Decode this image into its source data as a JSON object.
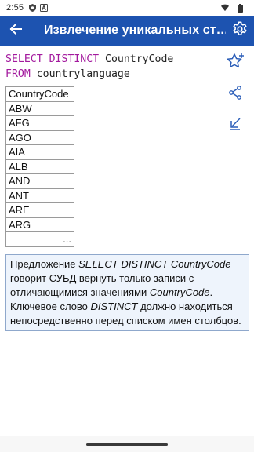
{
  "status_bar": {
    "time": "2:55",
    "icons": [
      "shield-icon",
      "a-icon",
      "wifi-icon",
      "battery-icon"
    ]
  },
  "app_bar": {
    "title": "Извлечение уникальных ст…",
    "back_icon": "arrow-back-icon",
    "settings_icon": "gear-icon",
    "background": "#1d53b0"
  },
  "query": {
    "line1_keyword": "SELECT DISTINCT",
    "line1_rest": " CountryCode",
    "line2_keyword": "FROM",
    "line2_rest": " countrylanguage",
    "keyword_color": "#a31a9e"
  },
  "side_actions": [
    {
      "name": "star-add-icon"
    },
    {
      "name": "share-icon"
    },
    {
      "name": "collapse-arrow-icon"
    }
  ],
  "result_table": {
    "header": "CountryCode",
    "rows": [
      "ABW",
      "AFG",
      "AGO",
      "AIA",
      "ALB",
      "AND",
      "ANT",
      "ARE",
      "ARG"
    ],
    "more": "..."
  },
  "note": {
    "t1": "Предложение ",
    "i1": "SELECT DISTINCT CountryCode",
    "t2": " говорит СУБД вернуть только записи с отличающимися значениями ",
    "i2": "CountryCode",
    "t3": ". Ключевое слово ",
    "i3": "DISTINCT",
    "t4": " должно находиться непосредственно перед списком имен столбцов."
  }
}
